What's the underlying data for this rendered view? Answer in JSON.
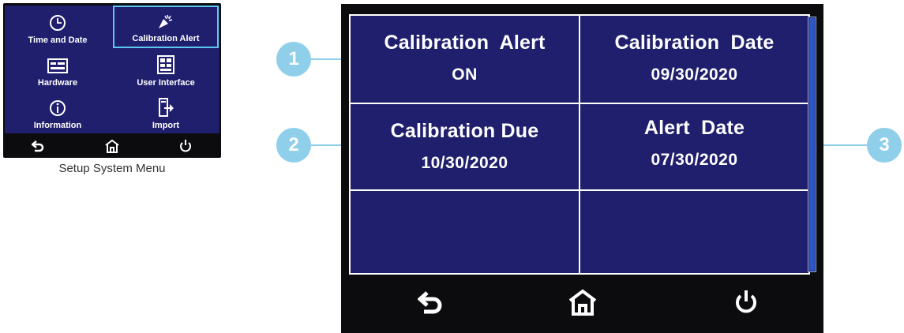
{
  "setup_menu": {
    "items": [
      {
        "label": "Time and Date",
        "icon": "clock-icon"
      },
      {
        "label": "Calibration Alert",
        "icon": "alert-icon",
        "selected": true
      },
      {
        "label": "Hardware",
        "icon": "hardware-icon"
      },
      {
        "label": "User Interface",
        "icon": "user-interface-icon"
      },
      {
        "label": "Information",
        "icon": "info-icon"
      },
      {
        "label": "Import",
        "icon": "import-icon"
      }
    ],
    "caption": "Setup System Menu"
  },
  "callouts": [
    "1",
    "2",
    "3"
  ],
  "calibration": {
    "alert_label": "Calibration  Alert",
    "alert_value": "ON",
    "date_label": "Calibration  Date",
    "date_value": "09/30/2020",
    "due_label": "Calibration Due",
    "due_value": "10/30/2020",
    "alert_date_label": "Alert  Date",
    "alert_date_value": "07/30/2020"
  },
  "colors": {
    "screen_background": "#1f1f6e",
    "bezel": "#0c0c0e",
    "highlight": "#5bc8ef",
    "callout": "#8fcfea",
    "scrollbar_thumb": "#2e57c6"
  },
  "nav_icons": [
    "back-icon",
    "home-icon",
    "power-icon"
  ]
}
